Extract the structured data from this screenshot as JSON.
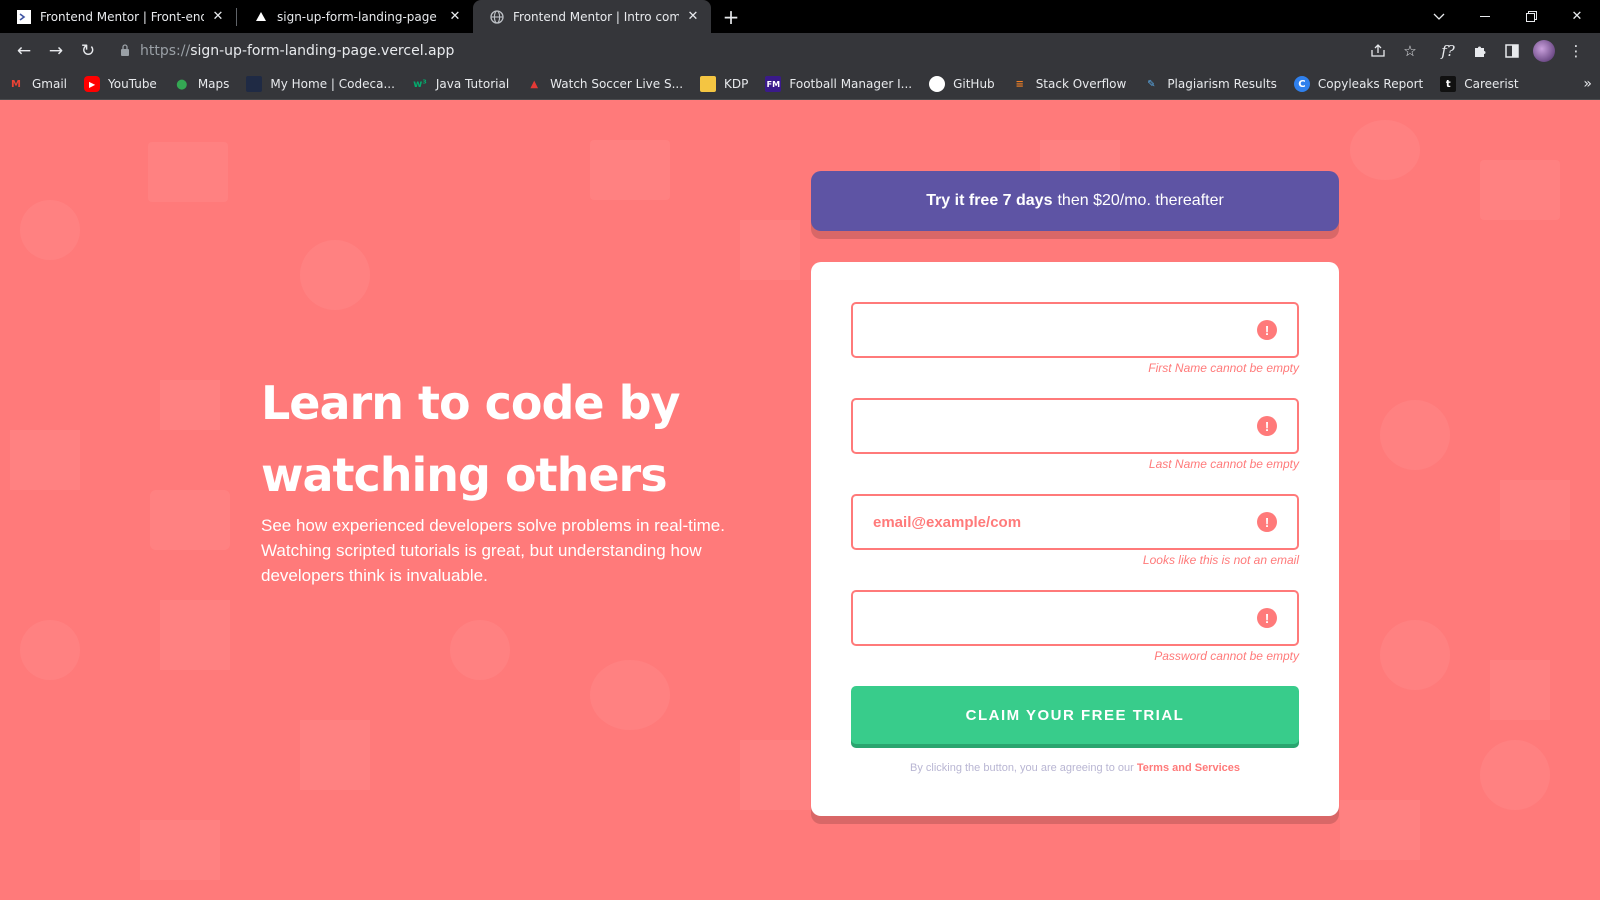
{
  "browser": {
    "tabs": [
      {
        "title": "Frontend Mentor | Front-end cod",
        "favicon": "frontend-mentor-icon",
        "active": false
      },
      {
        "title": "sign-up-form-landing-page – Ov",
        "favicon": "vercel-triangle-icon",
        "active": false
      },
      {
        "title": "Frontend Mentor | Intro compon",
        "favicon": "globe-icon",
        "active": true
      }
    ],
    "url_scheme": "https://",
    "url_host": "sign-up-form-landing-page.vercel.app",
    "bookmarks": [
      {
        "label": "Gmail",
        "icon": "gmail-icon",
        "color": "#ea4335"
      },
      {
        "label": "YouTube",
        "icon": "youtube-icon",
        "color": "#ff0000"
      },
      {
        "label": "Maps",
        "icon": "maps-icon",
        "color": "#34a853"
      },
      {
        "label": "My Home | Codeca...",
        "icon": "codecademy-icon",
        "color": "#1f2a44"
      },
      {
        "label": "Java Tutorial",
        "icon": "w3schools-icon",
        "color": "#04aa6d"
      },
      {
        "label": "Watch Soccer Live S...",
        "icon": "soccer-icon",
        "color": "#e53935"
      },
      {
        "label": "KDP",
        "icon": "kdp-icon",
        "color": "#f4c542"
      },
      {
        "label": "Football Manager I...",
        "icon": "fm-icon",
        "color": "#3a1a8a"
      },
      {
        "label": "GitHub",
        "icon": "github-icon",
        "color": "#ffffff"
      },
      {
        "label": "Stack Overflow",
        "icon": "stackoverflow-icon",
        "color": "#f48024"
      },
      {
        "label": "Plagiarism Results",
        "icon": "plagiarism-icon",
        "color": "#5aa9e6"
      },
      {
        "label": "Copyleaks Report",
        "icon": "copyleaks-icon",
        "color": "#2f80ed"
      },
      {
        "label": "Careerist",
        "icon": "careerist-icon",
        "color": "#111111"
      }
    ]
  },
  "hero": {
    "title_line1": "Learn to code by",
    "title_line2": "watching others",
    "description": "See how experienced developers solve problems in real-time. Watching scripted tutorials is great, but understanding how developers think is invaluable."
  },
  "promo": {
    "bold": "Try it free 7 days",
    "rest": "then $20/mo. thereafter"
  },
  "form": {
    "fields": [
      {
        "name": "first-name",
        "value": "",
        "error": "First Name cannot be empty"
      },
      {
        "name": "last-name",
        "value": "",
        "error": "Last Name cannot be empty"
      },
      {
        "name": "email",
        "value": "email@example/com",
        "error": "Looks like this is not an email"
      },
      {
        "name": "password",
        "value": "",
        "error": "Password cannot be empty"
      }
    ],
    "error_glyph": "!",
    "submit_label": "CLAIM YOUR FREE TRIAL",
    "terms_text": "By clicking the button, you are agreeing to our",
    "terms_link": "Terms and Services"
  },
  "colors": {
    "page_bg": "#ff7a7a",
    "promo_bg": "#5e54a4",
    "cta_bg": "#38cc8b",
    "error": "#ff7a7a"
  }
}
